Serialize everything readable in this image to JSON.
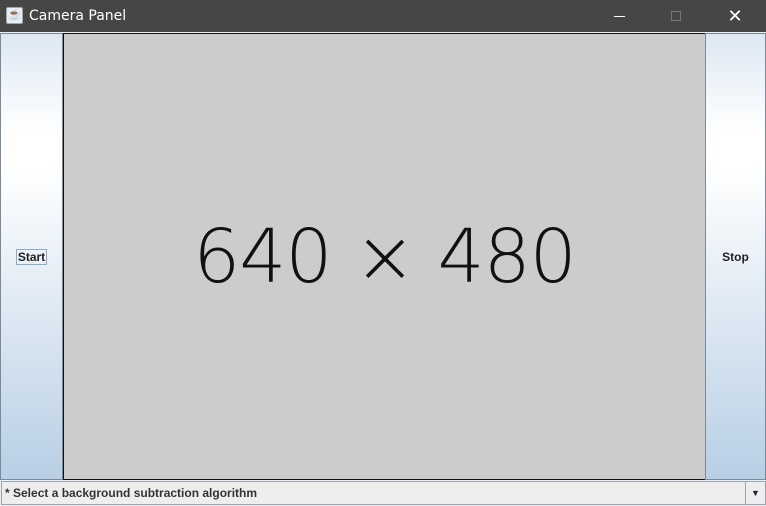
{
  "window": {
    "title": "Camera Panel"
  },
  "buttons": {
    "start": "Start",
    "stop": "Stop"
  },
  "video": {
    "placeholder": "640 × 480"
  },
  "algorithm_select": {
    "selected": "* Select a background subtraction algorithm"
  }
}
